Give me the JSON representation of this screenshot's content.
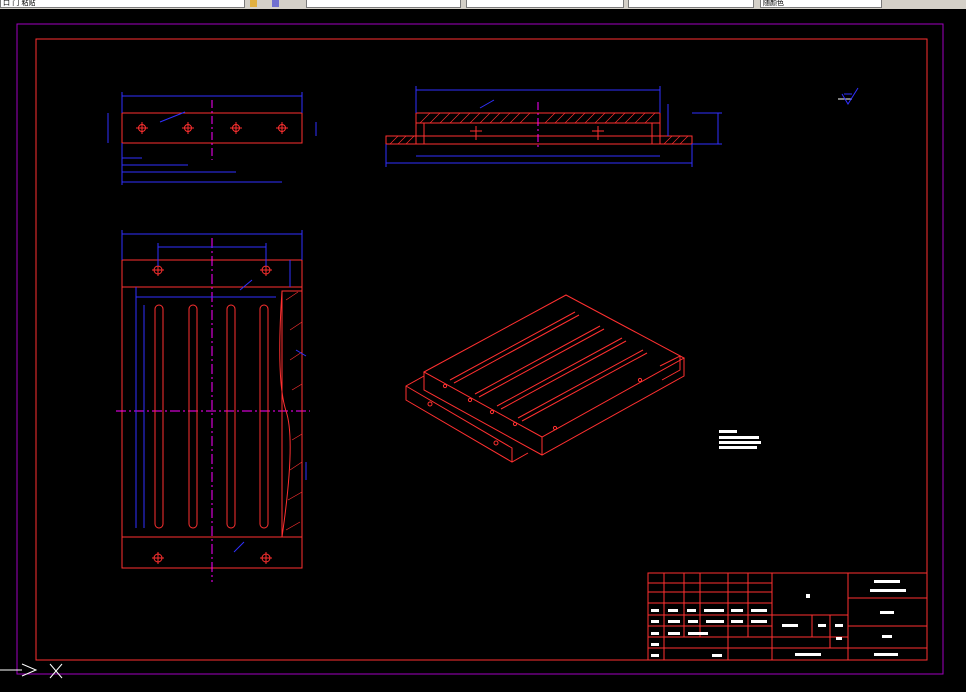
{
  "toolbar": {
    "layer_combo_label": "口 门 粘贴",
    "field_2": "",
    "field_3": "",
    "field_4": "",
    "field_5": "",
    "field_6": "随颜色"
  },
  "drawing": {
    "colors": {
      "sheet_border": "#a000c0",
      "frame": "#ff3030",
      "part_lines": "#ff3030",
      "dimensions": "#3030ff",
      "center_lines": "#ff00ff",
      "text_blocks": "#ffffff",
      "background": "#000000"
    },
    "cursor_icon": "ucs-cursor-icon"
  }
}
